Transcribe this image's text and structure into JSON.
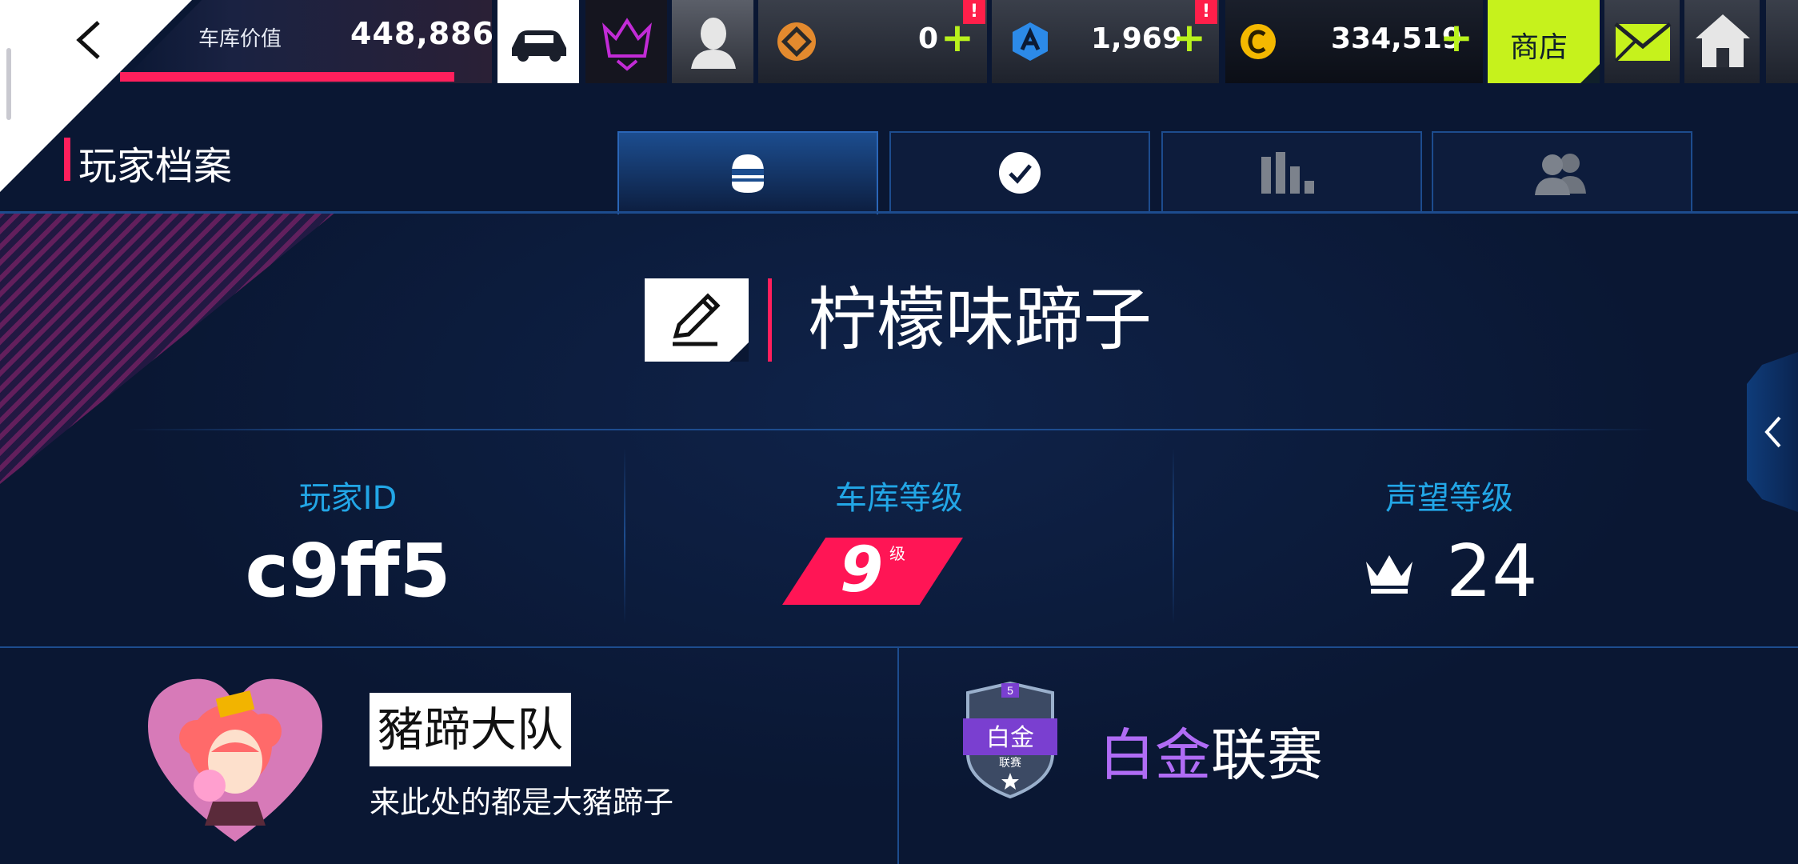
{
  "topbar": {
    "garage_value_label": "车库价值",
    "garage_value": "448,886",
    "garage_progress": 0.9,
    "tokens": {
      "value": "0",
      "plus": "+",
      "alert": "!"
    },
    "blueprints": {
      "value": "1,969",
      "plus": "+",
      "alert": "!"
    },
    "credits": {
      "value": "334,519",
      "plus": "+"
    },
    "shop_label": "商店"
  },
  "header": {
    "title": "玩家档案",
    "tabs": [
      {
        "name": "profile",
        "icon": "helmet-icon",
        "active": true
      },
      {
        "name": "achievements",
        "icon": "checkmark-icon",
        "active": false
      },
      {
        "name": "stats",
        "icon": "bar-chart-icon",
        "active": false
      },
      {
        "name": "friends",
        "icon": "friends-icon",
        "active": false
      }
    ]
  },
  "profile": {
    "player_name": "柠檬味蹄子",
    "stats": {
      "player_id_label": "玩家ID",
      "player_id": "c9ff5",
      "garage_level_label": "车库等级",
      "garage_level": "9",
      "garage_level_suffix": "级",
      "prestige_label": "声望等级",
      "prestige_level": "24"
    },
    "crew": {
      "name": "豬蹄大队",
      "description": "来此处的都是大豬蹄子"
    },
    "league": {
      "badge_text": "白金",
      "badge_sub": "联赛",
      "badge_level": "5",
      "name_accent": "白金",
      "name_rest": "联赛"
    }
  },
  "colors": {
    "background": "#0a1733",
    "accent_pink": "#ff1f5c",
    "accent_blue": "#22a6e6",
    "shop_green": "#c6f21c",
    "league_purple": "#b06cf5"
  }
}
